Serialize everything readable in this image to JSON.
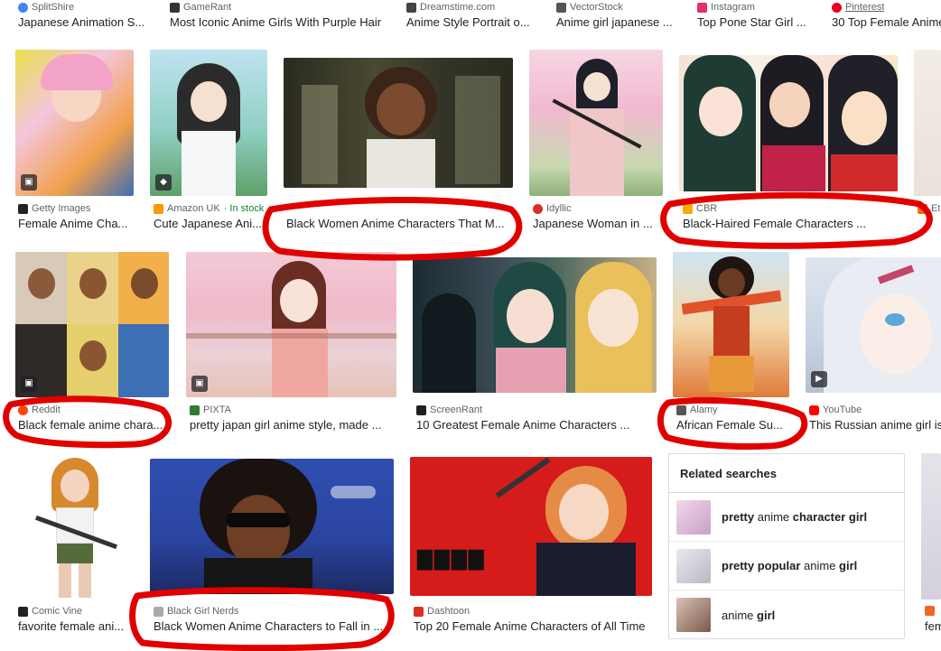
{
  "top_row": [
    {
      "source": "SplitShire",
      "title": "Japanese Animation S...",
      "fav": "#4285f4"
    },
    {
      "source": "GameRant",
      "title": "Most Iconic Anime Girls With Purple Hair",
      "fav": "#333333"
    },
    {
      "source": "Dreamstime.com",
      "title": "Anime Style Portrait o...",
      "fav": "#444444"
    },
    {
      "source": "VectorStock",
      "title": "Anime girl japanese ...",
      "fav": "#555555"
    },
    {
      "source": "Instagram",
      "title": "Top Pone Star Girl ...",
      "fav": "#e1306c"
    },
    {
      "source": "Pinterest",
      "title": "30 Top Female Anime",
      "fav": "#e60023"
    }
  ],
  "row1": [
    {
      "source": "Getty Images",
      "title": "Female Anime Cha...",
      "fav": "#222222",
      "badge": "image-icon"
    },
    {
      "source": "Amazon UK",
      "stock": "· In stock",
      "title": "Cute Japanese Ani...",
      "fav": "#ff9900",
      "badge": "tag-icon"
    },
    {
      "source": "",
      "title": "Black Women Anime Characters That M...",
      "fav": ""
    },
    {
      "source": "Idyllic",
      "title": "Japanese Woman in ...",
      "fav": "#d93025"
    },
    {
      "source": "CBR",
      "title": "Black-Haired Female Characters ...",
      "fav": "#f9ab00"
    },
    {
      "source": "Et",
      "title": "",
      "fav": "#e8710a"
    }
  ],
  "row2": [
    {
      "source": "Reddit",
      "title": "Black female anime chara...",
      "fav": "#ff4500",
      "badge": "image-icon"
    },
    {
      "source": "PIXTA",
      "title": "pretty japan girl anime style, made ...",
      "fav": "#2e7d32"
    },
    {
      "source": "ScreenRant",
      "title": "10 Greatest Female Anime Characters ...",
      "fav": "#1f1f1f"
    },
    {
      "source": "Alamy",
      "title": "African Female Su...",
      "fav": "#555555"
    },
    {
      "source": "YouTube",
      "title": "This Russian anime girl is",
      "fav": "#ff0000",
      "badge": "play-icon"
    }
  ],
  "row3": [
    {
      "source": "Comic Vine",
      "title": "favorite female ani...",
      "fav": "#222222"
    },
    {
      "source": "Black Girl Nerds",
      "title": "Black Women Anime Characters to Fall in ...",
      "fav": "#aaaaaa"
    },
    {
      "source": "Dashtoon",
      "title": "Top 20 Female Anime Characters of All Time",
      "fav": "#d93025"
    },
    {
      "source": "",
      "title": "fem",
      "fav": "#f26522"
    }
  ],
  "related": {
    "heading": "Related searches",
    "items": [
      {
        "pre": "pretty ",
        "plain": "anime ",
        "bold": "character girl",
        "color": "#c7a0c9"
      },
      {
        "pre": "pretty popular ",
        "plain": "anime ",
        "bold": "girl",
        "color": "#b9b9c3"
      },
      {
        "pre": "",
        "plain": "anime ",
        "bold": "girl",
        "color": "#7a5a4a"
      }
    ]
  },
  "annotation_color": "#e00000"
}
